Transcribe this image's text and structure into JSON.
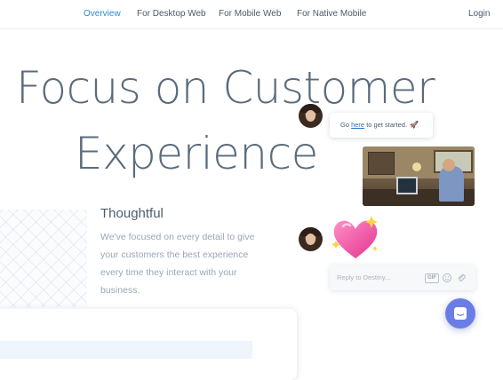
{
  "nav": {
    "links": [
      {
        "label": "Overview",
        "active": true
      },
      {
        "label": "For Desktop Web",
        "active": false
      },
      {
        "label": "For Mobile Web",
        "active": false
      },
      {
        "label": "For Native Mobile",
        "active": false
      }
    ],
    "login": "Login"
  },
  "hero": {
    "line1": "Focus on Customer",
    "line2": "Experience"
  },
  "feature": {
    "title": "Thoughtful",
    "body": "We've focused on every detail to give your customers the best experience every time they interact with your business."
  },
  "chat": {
    "message_prefix": "Go ",
    "message_link": "here",
    "message_suffix": " to get started.",
    "rocket_icon": "🚀",
    "reply_placeholder": "Reply to Destiny...",
    "gif_label": "GIF",
    "heart_icon": "sparkling-heart-emoji"
  },
  "colors": {
    "accent": "#2b8ad8",
    "launcher": "#6a7de6",
    "heading": "#5a6b7c"
  }
}
